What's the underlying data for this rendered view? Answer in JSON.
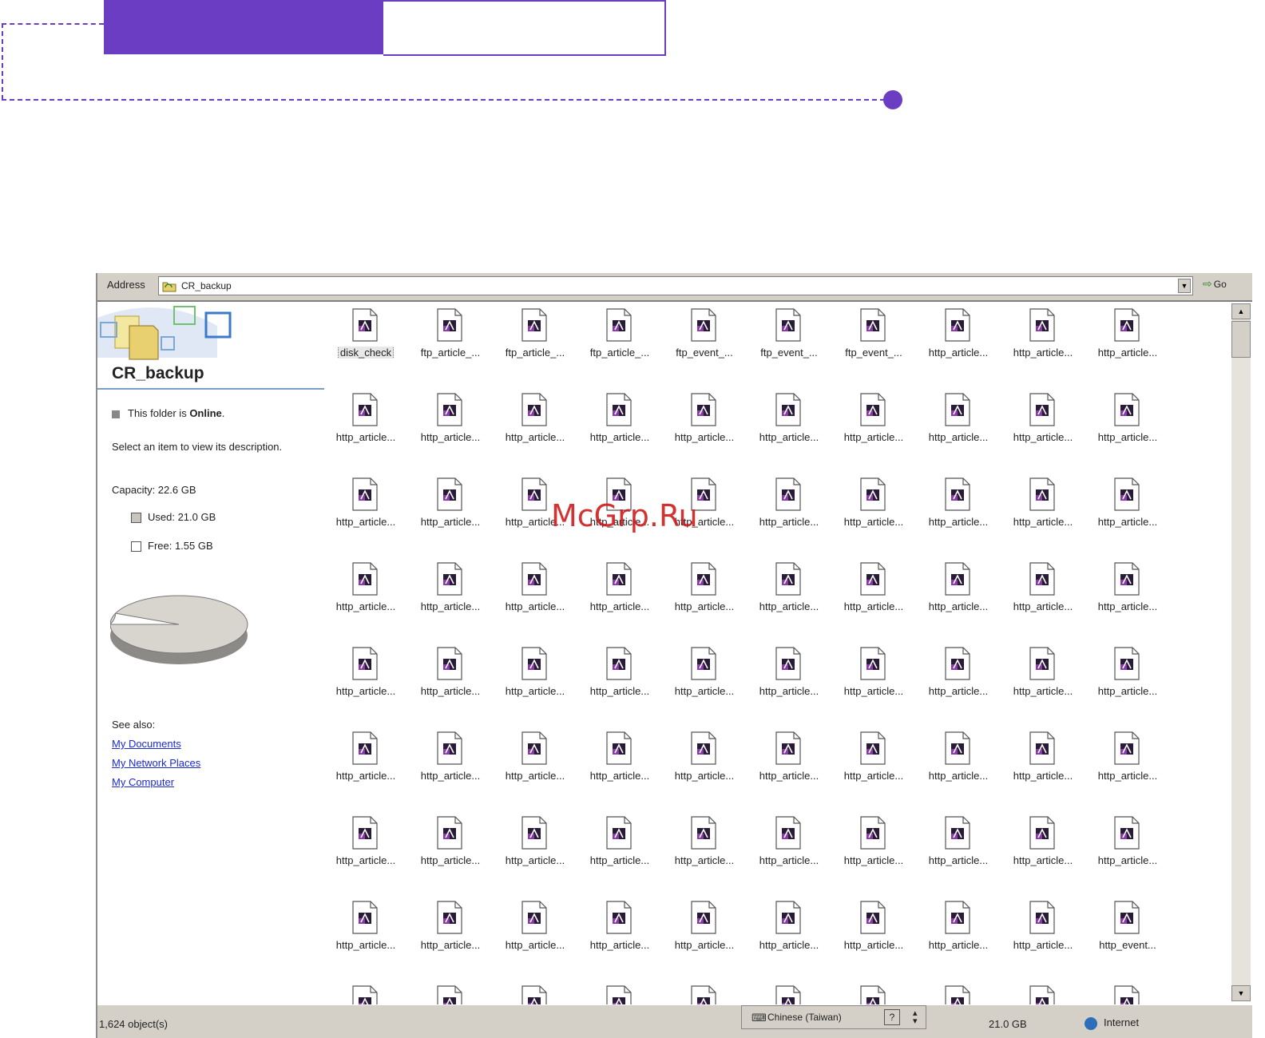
{
  "colors": {
    "accent": "#6a3dc2",
    "link": "#1a2ad8",
    "chrome": "#d4d0c8",
    "watermark": "#cf1c1c"
  },
  "address": {
    "label": "Address",
    "value": "CR_backup",
    "go_label": "Go"
  },
  "left_panel": {
    "folder_name": "CR_backup",
    "status_prefix": "This folder is ",
    "status_value": "Online",
    "status_suffix": ".",
    "description": "Select an item to view its description.",
    "capacity": "Capacity: 22.6 GB",
    "used": "Used: 21.0 GB",
    "free": "Free: 1.55 GB",
    "disk_usage_fraction": 0.93,
    "see_also_label": "See also:",
    "links": [
      "My Documents",
      "My Network Places",
      "My Computer"
    ]
  },
  "files": [
    "disk_check",
    "ftp_article_...",
    "ftp_article_...",
    "ftp_article_...",
    "ftp_event_...",
    "ftp_event_...",
    "ftp_event_...",
    "http_article...",
    "http_article...",
    "http_article...",
    "http_article...",
    "http_article...",
    "http_article...",
    "http_article...",
    "http_article...",
    "http_article...",
    "http_article...",
    "http_article...",
    "http_article...",
    "http_article...",
    "http_article...",
    "http_article...",
    "http_article...",
    "http_article...",
    "http_article...",
    "http_article...",
    "http_article...",
    "http_article...",
    "http_article...",
    "http_article...",
    "http_article...",
    "http_article...",
    "http_article...",
    "http_article...",
    "http_article...",
    "http_article...",
    "http_article...",
    "http_article...",
    "http_article...",
    "http_article...",
    "http_article...",
    "http_article...",
    "http_article...",
    "http_article...",
    "http_article...",
    "http_article...",
    "http_article...",
    "http_article...",
    "http_article...",
    "http_article...",
    "http_article...",
    "http_article...",
    "http_article...",
    "http_article...",
    "http_article...",
    "http_article...",
    "http_article...",
    "http_article...",
    "http_article...",
    "http_article...",
    "http_article...",
    "http_article...",
    "http_article...",
    "http_article...",
    "http_article...",
    "http_article...",
    "http_article...",
    "http_article...",
    "http_article...",
    "http_article...",
    "http_article...",
    "http_article...",
    "http_article...",
    "http_article...",
    "http_article...",
    "http_article...",
    "http_article...",
    "http_article...",
    "http_article...",
    "http_event...",
    "",
    "",
    "",
    "",
    "",
    "",
    "",
    "",
    "",
    ""
  ],
  "selected_file_index": 0,
  "status": {
    "count": "1,624 object(s)",
    "ime_label": "Chinese (Taiwan)",
    "size": "21.0 GB",
    "zone": "Internet"
  },
  "watermark": "McGrp.Ru"
}
